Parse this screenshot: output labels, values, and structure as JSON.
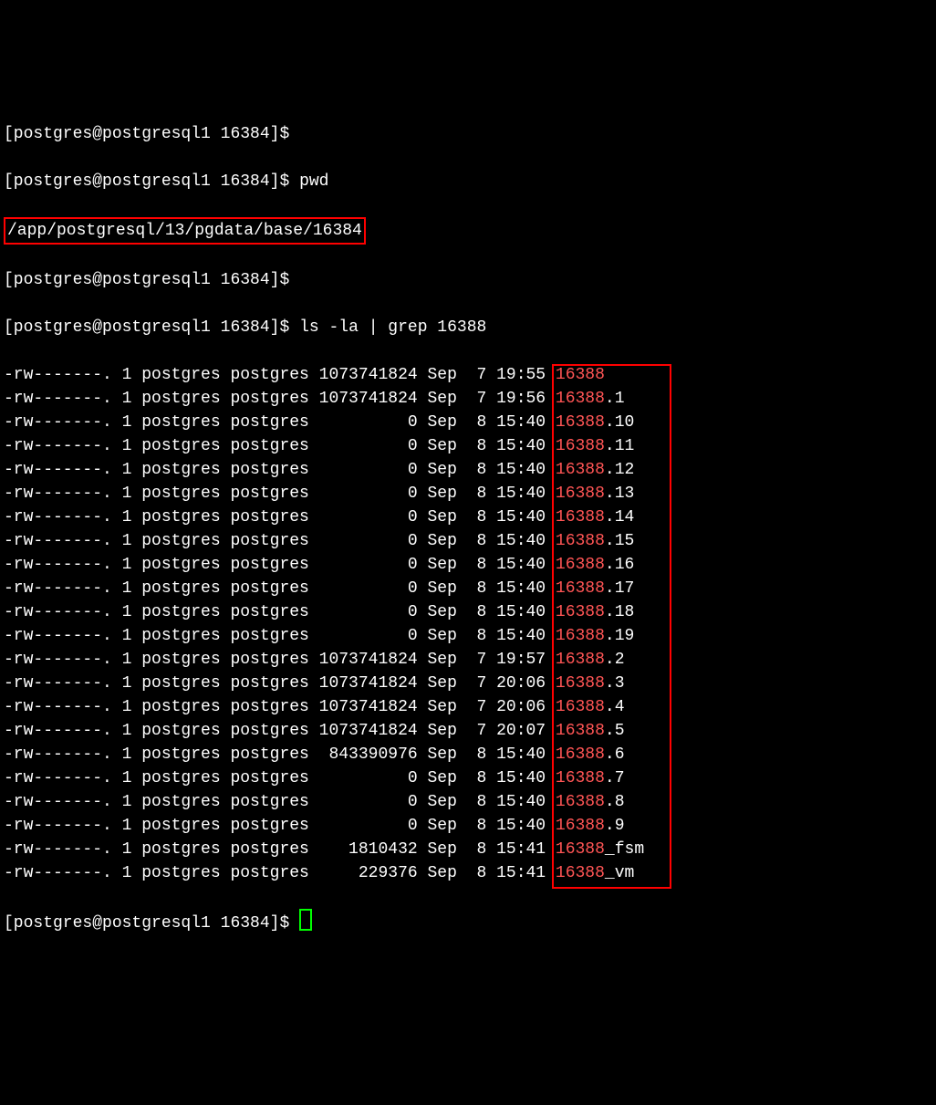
{
  "prompt": "[postgres@postgresql1 16384]$",
  "pwd_cmd": "pwd",
  "pwd_output": "/app/postgresql/13/pgdata/base/16384",
  "ls_cmd": "ls -la | grep 16388",
  "rows": [
    {
      "perm": "-rw-------.",
      "n": "1",
      "u": "postgres",
      "g": "postgres",
      "size": "1073741824",
      "mon": "Sep",
      "day": " 7",
      "time": "19:55",
      "file": "16388",
      "suffix": ""
    },
    {
      "perm": "-rw-------.",
      "n": "1",
      "u": "postgres",
      "g": "postgres",
      "size": "1073741824",
      "mon": "Sep",
      "day": " 7",
      "time": "19:56",
      "file": "16388",
      "suffix": ".1"
    },
    {
      "perm": "-rw-------.",
      "n": "1",
      "u": "postgres",
      "g": "postgres",
      "size": "         0",
      "mon": "Sep",
      "day": " 8",
      "time": "15:40",
      "file": "16388",
      "suffix": ".10"
    },
    {
      "perm": "-rw-------.",
      "n": "1",
      "u": "postgres",
      "g": "postgres",
      "size": "         0",
      "mon": "Sep",
      "day": " 8",
      "time": "15:40",
      "file": "16388",
      "suffix": ".11"
    },
    {
      "perm": "-rw-------.",
      "n": "1",
      "u": "postgres",
      "g": "postgres",
      "size": "         0",
      "mon": "Sep",
      "day": " 8",
      "time": "15:40",
      "file": "16388",
      "suffix": ".12"
    },
    {
      "perm": "-rw-------.",
      "n": "1",
      "u": "postgres",
      "g": "postgres",
      "size": "         0",
      "mon": "Sep",
      "day": " 8",
      "time": "15:40",
      "file": "16388",
      "suffix": ".13"
    },
    {
      "perm": "-rw-------.",
      "n": "1",
      "u": "postgres",
      "g": "postgres",
      "size": "         0",
      "mon": "Sep",
      "day": " 8",
      "time": "15:40",
      "file": "16388",
      "suffix": ".14"
    },
    {
      "perm": "-rw-------.",
      "n": "1",
      "u": "postgres",
      "g": "postgres",
      "size": "         0",
      "mon": "Sep",
      "day": " 8",
      "time": "15:40",
      "file": "16388",
      "suffix": ".15"
    },
    {
      "perm": "-rw-------.",
      "n": "1",
      "u": "postgres",
      "g": "postgres",
      "size": "         0",
      "mon": "Sep",
      "day": " 8",
      "time": "15:40",
      "file": "16388",
      "suffix": ".16"
    },
    {
      "perm": "-rw-------.",
      "n": "1",
      "u": "postgres",
      "g": "postgres",
      "size": "         0",
      "mon": "Sep",
      "day": " 8",
      "time": "15:40",
      "file": "16388",
      "suffix": ".17"
    },
    {
      "perm": "-rw-------.",
      "n": "1",
      "u": "postgres",
      "g": "postgres",
      "size": "         0",
      "mon": "Sep",
      "day": " 8",
      "time": "15:40",
      "file": "16388",
      "suffix": ".18"
    },
    {
      "perm": "-rw-------.",
      "n": "1",
      "u": "postgres",
      "g": "postgres",
      "size": "         0",
      "mon": "Sep",
      "day": " 8",
      "time": "15:40",
      "file": "16388",
      "suffix": ".19"
    },
    {
      "perm": "-rw-------.",
      "n": "1",
      "u": "postgres",
      "g": "postgres",
      "size": "1073741824",
      "mon": "Sep",
      "day": " 7",
      "time": "19:57",
      "file": "16388",
      "suffix": ".2"
    },
    {
      "perm": "-rw-------.",
      "n": "1",
      "u": "postgres",
      "g": "postgres",
      "size": "1073741824",
      "mon": "Sep",
      "day": " 7",
      "time": "20:06",
      "file": "16388",
      "suffix": ".3"
    },
    {
      "perm": "-rw-------.",
      "n": "1",
      "u": "postgres",
      "g": "postgres",
      "size": "1073741824",
      "mon": "Sep",
      "day": " 7",
      "time": "20:06",
      "file": "16388",
      "suffix": ".4"
    },
    {
      "perm": "-rw-------.",
      "n": "1",
      "u": "postgres",
      "g": "postgres",
      "size": "1073741824",
      "mon": "Sep",
      "day": " 7",
      "time": "20:07",
      "file": "16388",
      "suffix": ".5"
    },
    {
      "perm": "-rw-------.",
      "n": "1",
      "u": "postgres",
      "g": "postgres",
      "size": " 843390976",
      "mon": "Sep",
      "day": " 8",
      "time": "15:40",
      "file": "16388",
      "suffix": ".6"
    },
    {
      "perm": "-rw-------.",
      "n": "1",
      "u": "postgres",
      "g": "postgres",
      "size": "         0",
      "mon": "Sep",
      "day": " 8",
      "time": "15:40",
      "file": "16388",
      "suffix": ".7"
    },
    {
      "perm": "-rw-------.",
      "n": "1",
      "u": "postgres",
      "g": "postgres",
      "size": "         0",
      "mon": "Sep",
      "day": " 8",
      "time": "15:40",
      "file": "16388",
      "suffix": ".8"
    },
    {
      "perm": "-rw-------.",
      "n": "1",
      "u": "postgres",
      "g": "postgres",
      "size": "         0",
      "mon": "Sep",
      "day": " 8",
      "time": "15:40",
      "file": "16388",
      "suffix": ".9"
    },
    {
      "perm": "-rw-------.",
      "n": "1",
      "u": "postgres",
      "g": "postgres",
      "size": "   1810432",
      "mon": "Sep",
      "day": " 8",
      "time": "15:41",
      "file": "16388",
      "suffix": "_fsm"
    },
    {
      "perm": "-rw-------.",
      "n": "1",
      "u": "postgres",
      "g": "postgres",
      "size": "    229376",
      "mon": "Sep",
      "day": " 8",
      "time": "15:41",
      "file": "16388",
      "suffix": "_vm"
    }
  ],
  "highlight_colors": {
    "box_border": "#ff0000",
    "filename": "#ff5555",
    "cursor": "#00ff00"
  }
}
